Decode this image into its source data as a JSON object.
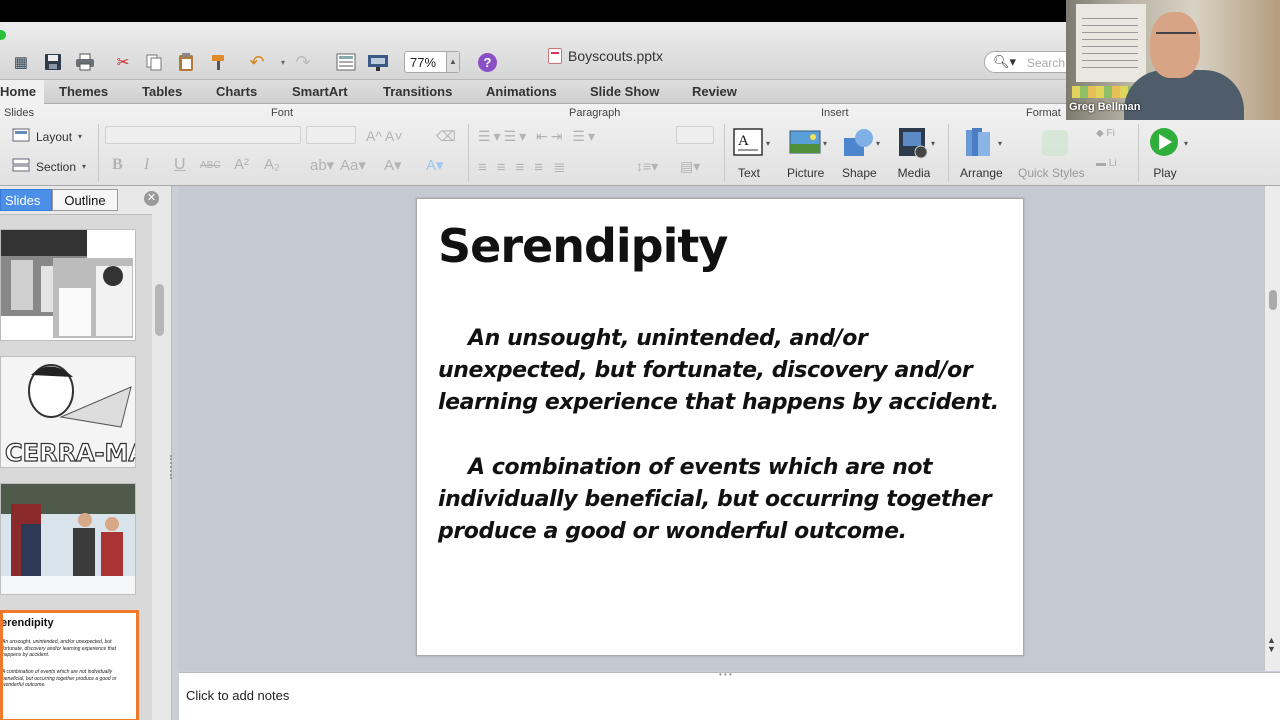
{
  "window": {
    "title": "Boyscouts.pptx"
  },
  "toolbar": {
    "zoom_value": "77%",
    "search_placeholder": "Search",
    "help_label": "?"
  },
  "ribbon_tabs": [
    "Home",
    "Themes",
    "Tables",
    "Charts",
    "SmartArt",
    "Transitions",
    "Animations",
    "Slide Show",
    "Review"
  ],
  "ribbon_groups": {
    "slides": "Slides",
    "font": "Font",
    "paragraph": "Paragraph",
    "insert": "Insert",
    "format": "Format"
  },
  "ribbon_buttons": {
    "layout": "Layout",
    "section": "Section",
    "text": "Text",
    "picture": "Picture",
    "shape": "Shape",
    "media": "Media",
    "arrange": "Arrange",
    "quick_styles": "Quick Styles",
    "play": "Play"
  },
  "left_panel": {
    "tabs": [
      "Slides",
      "Outline"
    ],
    "active_tab": "Slides",
    "thumb_cerraman": "CERRA-MAN",
    "thumb_selected_title": "erendipity",
    "thumb_selected_p1": "An unsought, unintended, and/or unexpected, but fortunate, discovery and/or learning experience that happens by accident.",
    "thumb_selected_p2": "A combination of events which are not individually beneficial, but occurring together produce a good or wonderful outcome."
  },
  "slide": {
    "title": "Serendipity",
    "paragraph1": "An unsought, unintended, and/or unexpected, but fortunate, discovery and/or learning experience that happens by accident.",
    "paragraph2": "A combination of events which are not individually beneficial, but occurring together produce a good or wonderful outcome."
  },
  "notes": {
    "placeholder": "Click to add notes"
  },
  "video": {
    "participant_name": "Greg Bellman"
  },
  "colors": {
    "active_tab": "#4b8fe8",
    "selected_thumb_border": "#f07a2a",
    "play_green": "#2fae3a",
    "help_purple": "#8a4fc4"
  }
}
